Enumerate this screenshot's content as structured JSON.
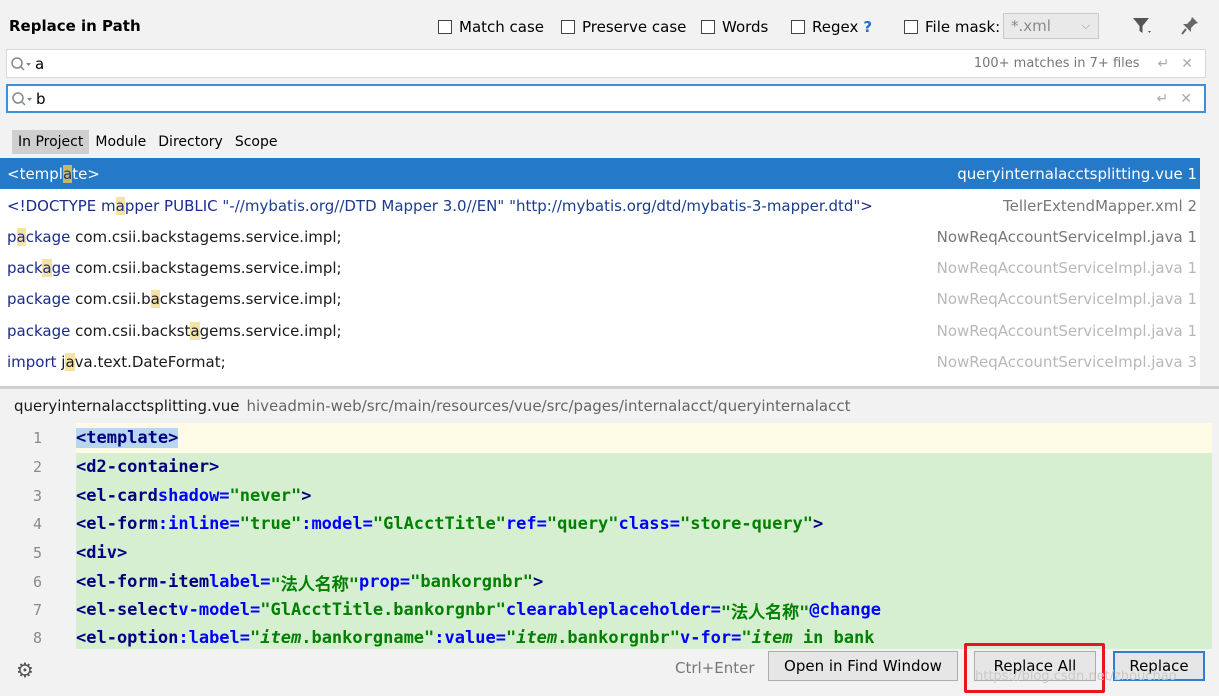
{
  "header": {
    "title": "Replace in Path",
    "options": [
      {
        "label": "Match case",
        "checked": false
      },
      {
        "label": "Preserve case",
        "checked": false
      },
      {
        "label": "Words",
        "checked": false
      },
      {
        "label": "Regex",
        "checked": false
      },
      {
        "label": "File mask:",
        "checked": false
      }
    ],
    "regex_help": "?",
    "file_mask_value": "*.xml",
    "filter_icon": "filter-icon",
    "pin_icon": "pin-icon"
  },
  "search": {
    "value": "a",
    "match_count": "100+ matches in 7+ files"
  },
  "replace": {
    "value": "b"
  },
  "scope": {
    "tabs": [
      "In Project",
      "Module",
      "Directory",
      "Scope"
    ],
    "selected": "In Project"
  },
  "results": [
    {
      "text": "<template>",
      "file": "queryinternalacctsplitting.vue 1",
      "selected": true
    },
    {
      "text": "<!DOCTYPE mapper PUBLIC \"-//mybatis.org//DTD Mapper 3.0//EN\" \"http://mybatis.org/dtd/mybatis-3-mapper.dtd\">",
      "file": "TellerExtendMapper.xml 2"
    },
    {
      "text": "package com.csii.backstagems.service.impl;",
      "file": "NowReqAccountServiceImpl.java 1"
    },
    {
      "text": "package com.csii.backstagems.service.impl;",
      "file": "NowReqAccountServiceImpl.java 1"
    },
    {
      "text": "package com.csii.backstagems.service.impl;",
      "file": "NowReqAccountServiceImpl.java 1"
    },
    {
      "text": "package com.csii.backstagems.service.impl;",
      "file": "NowReqAccountServiceImpl.java 1"
    },
    {
      "text": "import java.text.DateFormat;",
      "file": "NowReqAccountServiceImpl.java 3"
    }
  ],
  "preview": {
    "file_name": "queryinternalacctsplitting.vue",
    "path": "hiveadmin-web/src/main/resources/vue/src/pages/internalacct/queryinternalacct",
    "line_numbers": [
      "1",
      "2",
      "3",
      "4",
      "5",
      "6",
      "7",
      "8"
    ],
    "lines": [
      "<template>",
      "<d2-container>",
      "<el-card shadow=\"never\">",
      "<el-form :inline=\"true\" :model=\"GlAcctTitle\" ref=\"query\" class=\"store-query\">",
      "<div>",
      "<el-form-item label=\"法人名称\" prop=\"bankorgnbr\">",
      "<el-select v-model=\"GlAcctTitle.bankorgnbr\" clearable placeholder=\"法人名称\" @change",
      "<el-option :label=\"item.bankorgname\" :value=\"item.bankorgnbr\" v-for=\"item in bank"
    ]
  },
  "footer": {
    "shortcut": "Ctrl+Enter",
    "open_in_find_window": "Open in Find Window",
    "replace_all": "Replace All",
    "replace": "Replace",
    "watermark": "https://blog.csdn.net/zhouchao"
  },
  "colors": {
    "selection": "#2479c8",
    "highlight": "#f4e3a3",
    "editor_bg": "#d6efd0",
    "annotation": "#e8171b"
  }
}
